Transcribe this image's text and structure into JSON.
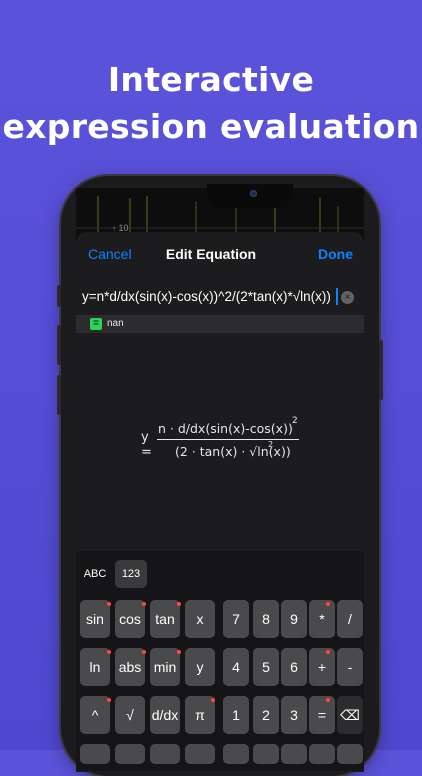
{
  "headline": {
    "line1": "Interactive",
    "line2": "expression evaluation"
  },
  "graph": {
    "axis_tick": "10"
  },
  "nav": {
    "cancel": "Cancel",
    "title": "Edit Equation",
    "done": "Done"
  },
  "input": {
    "value": "y=n*d/dx(sin(x)-cos(x))^2/(2*tan(x)*√ln(x))",
    "clear_icon": "x-circle-icon"
  },
  "result": {
    "icon": "=",
    "value": "nan"
  },
  "formula": {
    "lhs": "y",
    "equals": "=",
    "numerator": "n · d/dx(sin(x)-cos(x))",
    "exponent": "2",
    "denominator": "(2 · tan(x) · √ln(x))",
    "root_index": "2"
  },
  "keyboard": {
    "tabs": [
      "ABC",
      "123"
    ],
    "rows": [
      [
        "sin",
        "cos",
        "tan",
        "x",
        "7",
        "8",
        "9",
        "*",
        "/"
      ],
      [
        "ln",
        "abs",
        "min",
        "y",
        "4",
        "5",
        "6",
        "+",
        "-"
      ],
      [
        "^",
        "√",
        "d/dx",
        "π",
        "1",
        "2",
        "3",
        "=",
        "⌫"
      ]
    ]
  },
  "colors": {
    "background": "#5b53d9",
    "accent": "#0a84ff",
    "result_badge": "#30d158",
    "key": "#4a4a4c"
  }
}
